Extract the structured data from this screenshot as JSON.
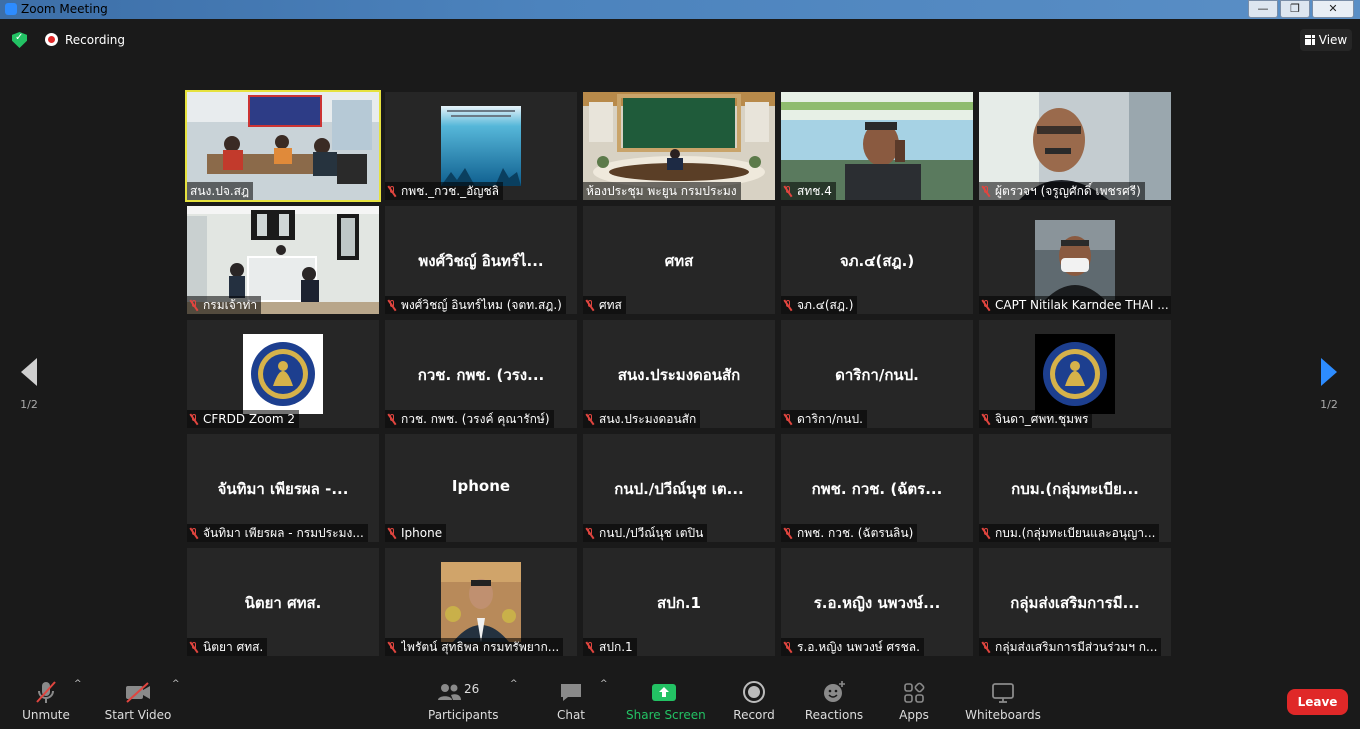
{
  "window": {
    "title": "Zoom Meeting"
  },
  "status": {
    "recording": "Recording",
    "view": "View"
  },
  "pager": {
    "left_page": "1/2",
    "right_page": "1/2"
  },
  "tiles": [
    {
      "name": "สนง.ปจ.สฎ",
      "big": "",
      "kind": "video-room-1",
      "active": true,
      "muted": false
    },
    {
      "name": "กพช._กวช._อัญชลิ",
      "big": "",
      "kind": "image-ocean",
      "muted": true
    },
    {
      "name": "ห้องประชุม พะยูน กรมประมง",
      "big": "",
      "kind": "video-hall",
      "muted": false
    },
    {
      "name": "สทช.4",
      "big": "",
      "kind": "video-man-phone",
      "muted": true
    },
    {
      "name": "ผู้ตรวจฯ (จรูญศักดิ์ เพชรศรี)",
      "big": "",
      "kind": "video-man-glasses",
      "muted": true
    },
    {
      "name": "กรมเจ้าท่า",
      "big": "",
      "kind": "video-office",
      "muted": true
    },
    {
      "name": "พงศ์วิชญ์ อินทร์ไหม (จตท.สฎ.)",
      "big": "พงศ์วิชญ์ อินทร์ไ...",
      "kind": "text",
      "muted": true
    },
    {
      "name": "ศทส",
      "big": "ศทส",
      "kind": "text",
      "muted": true
    },
    {
      "name": "จภ.๔(สฎ.)",
      "big": "จภ.๔(สฎ.)",
      "kind": "text",
      "muted": true
    },
    {
      "name": "CAPT Nitilak Karndee THAI ...",
      "big": "",
      "kind": "photo-mask",
      "muted": true
    },
    {
      "name": "CFRDD Zoom 2",
      "big": "",
      "kind": "logo",
      "muted": true
    },
    {
      "name": "กวช. กพช.  (วรงค์ คุณารักษ์)",
      "big": "กวช. กพช.  (วรง...",
      "kind": "text",
      "muted": true
    },
    {
      "name": "สนง.ประมงดอนสัก",
      "big": "สนง.ประมงดอนสัก",
      "kind": "text",
      "muted": true
    },
    {
      "name": "ดาริกา/กนป.",
      "big": "ดาริกา/กนป.",
      "kind": "text",
      "muted": true
    },
    {
      "name": "จินดา_ศพท.ชุมพร",
      "big": "",
      "kind": "logo-dark",
      "muted": true
    },
    {
      "name": "จันทิมา เพียรผล - กรมประมง...",
      "big": "จันทิมา เพียรผล -...",
      "kind": "text",
      "muted": true
    },
    {
      "name": "Iphone",
      "big": "Iphone",
      "kind": "text",
      "muted": true
    },
    {
      "name": "กนป./ปวีณ์นุช เตปิน",
      "big": "กนป./ปวีณ์นุช เต...",
      "kind": "text",
      "muted": true
    },
    {
      "name": "กพช. กวช. (ฉัตรนลิน)",
      "big": "กพช. กวช. (ฉัตร...",
      "kind": "text",
      "muted": true
    },
    {
      "name": "กบม.(กลุ่มทะเบียนและอนุญา...",
      "big": "กบม.(กลุ่มทะเบีย...",
      "kind": "text",
      "muted": true
    },
    {
      "name": "นิตยา ศทส.",
      "big": "นิตยา ศทส.",
      "kind": "text",
      "muted": true
    },
    {
      "name": "ไพรัตน์ สุทธิพล กรมทรัพยาก...",
      "big": "",
      "kind": "photo-suit",
      "muted": true
    },
    {
      "name": "สปก.1",
      "big": "สปก.1",
      "kind": "text",
      "muted": true
    },
    {
      "name": "ร.อ.หญิง นพวงษ์ ศรชล.",
      "big": "ร.อ.หญิง นพวงษ์...",
      "kind": "text",
      "muted": true
    },
    {
      "name": "กลุ่มส่งเสริมการมีส่วนร่วมฯ ก...",
      "big": "กลุ่มส่งเสริมการมี...",
      "kind": "text",
      "muted": true
    }
  ],
  "toolbar": {
    "unmute": "Unmute",
    "start_video": "Start Video",
    "participants": "Participants",
    "participants_count": "26",
    "chat": "Chat",
    "share_screen": "Share Screen",
    "record": "Record",
    "reactions": "Reactions",
    "apps": "Apps",
    "whiteboards": "Whiteboards",
    "leave": "Leave"
  },
  "colors": {
    "accent": "#2d8cff",
    "share": "#23c264",
    "leave": "#e02828",
    "active_speaker": "#e6e23e"
  }
}
